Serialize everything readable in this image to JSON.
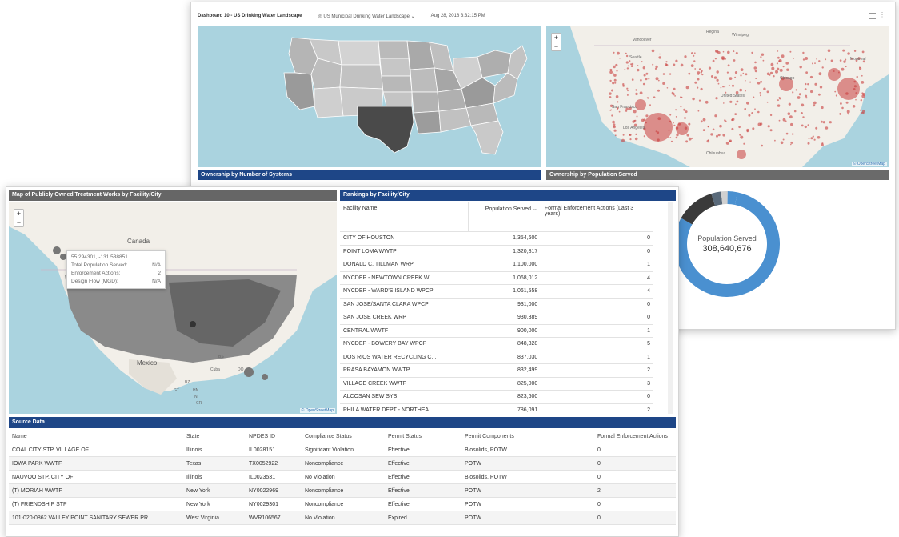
{
  "dashboard": {
    "title": "Dashboard 10 - US Drinking Water Landscape",
    "datasource": "US Municipal Drinking Water Landscape",
    "timestamp": "Aug 28, 2018 3:32:15 PM"
  },
  "panels": {
    "ownership_systems": "Ownership by Number of Systems",
    "ownership_population": "Ownership by Population Served",
    "potw_map": "Map of Publicly Owned Treatment Works by Facility/City",
    "rankings": "Rankings by Facility/City",
    "source_data": "Source Data"
  },
  "attribution": "© OpenStreetMap",
  "zoom": {
    "plus": "+",
    "minus": "−"
  },
  "map_labels": {
    "vancouver": "Vancouver",
    "regina": "Regina",
    "winnipeg": "Winnipeg",
    "seattle": "Seattle",
    "montreal": "Montreal",
    "united_states": "United States",
    "chicago": "Chicago",
    "san_francisco": "San Francisco",
    "los_angeles": "Los Angeles",
    "chihuahua": "Chihuahua",
    "canada": "Canada",
    "mexico": "Mexico",
    "cuba": "Cuba",
    "bs": "BS",
    "do": "DO",
    "bz": "BZ",
    "gt": "GT",
    "hn": "HN",
    "ni": "NI",
    "cr": "CR"
  },
  "donut": {
    "label": "Population Served",
    "value": "308,640,676",
    "segments": [
      {
        "fraction": 0.8,
        "color": "#4a90d0"
      },
      {
        "fraction": 0.12,
        "color": "#3a3a3a"
      },
      {
        "fraction": 0.03,
        "color": "#5a6a7a"
      },
      {
        "fraction": 0.02,
        "color": "#d0d0d0"
      },
      {
        "fraction": 0.03,
        "color": "#4a90d0"
      }
    ]
  },
  "tooltip": {
    "coords": "55.294301, -131.538851",
    "rows": [
      {
        "label": "Total Population Served:",
        "value": "N/A"
      },
      {
        "label": "Enforcement Actions:",
        "value": "2"
      },
      {
        "label": "Design Flow (MGD):",
        "value": "N/A"
      }
    ]
  },
  "rankings": {
    "columns": [
      "Facility Name",
      "Population Served",
      "Formal Enforcement Actions (Last 3 years)"
    ],
    "rows": [
      [
        "CITY OF HOUSTON",
        "1,354,600",
        "0"
      ],
      [
        "POINT LOMA WWTP",
        "1,320,817",
        "0"
      ],
      [
        "DONALD C. TILLMAN WRP",
        "1,100,000",
        "1"
      ],
      [
        "NYCDEP - NEWTOWN CREEK W...",
        "1,068,012",
        "4"
      ],
      [
        "NYCDEP - WARD'S ISLAND WPCP",
        "1,061,558",
        "4"
      ],
      [
        "SAN JOSE/SANTA CLARA WPCP",
        "931,000",
        "0"
      ],
      [
        "SAN JOSE CREEK WRP",
        "930,389",
        "0"
      ],
      [
        "CENTRAL WWTF",
        "900,000",
        "1"
      ],
      [
        "NYCDEP - BOWERY BAY WPCP",
        "848,328",
        "5"
      ],
      [
        "DOS RIOS WATER RECYCLING C...",
        "837,030",
        "1"
      ],
      [
        "PRASA BAYAMON WWTP",
        "832,499",
        "2"
      ],
      [
        "VILLAGE CREEK WWTF",
        "825,000",
        "3"
      ],
      [
        "ALCOSAN SEW SYS",
        "823,600",
        "0"
      ],
      [
        "PHILA WATER DEPT - NORTHEA...",
        "786,091",
        "2"
      ]
    ]
  },
  "source": {
    "columns": [
      "Name",
      "State",
      "NPDES ID",
      "Compliance Status",
      "Permit Status",
      "Permit Components",
      "Formal Enforcement Actions"
    ],
    "rows": [
      [
        "COAL CITY STP, VILLAGE OF",
        "Illinois",
        "IL0028151",
        "Significant Violation",
        "Effective",
        "Biosolids, POTW",
        "0"
      ],
      [
        "IOWA PARK WWTF",
        "Texas",
        "TX0052922",
        "Noncompliance",
        "Effective",
        "POTW",
        "0"
      ],
      [
        "NAUVOO STP, CITY OF",
        "Illinois",
        "IL0023531",
        "No Violation",
        "Effective",
        "Biosolids, POTW",
        "0"
      ],
      [
        "(T) MORIAH WWTF",
        "New York",
        "NY0022969",
        "Noncompliance",
        "Effective",
        "POTW",
        "2"
      ],
      [
        "(T) FRIENDSHIP STP",
        "New York",
        "NY0029301",
        "Noncompliance",
        "Effective",
        "POTW",
        "0"
      ],
      [
        "101-020-0862 VALLEY POINT SANITARY SEWER PR...",
        "West Virginia",
        "WVR106567",
        "No Violation",
        "Expired",
        "POTW",
        "0"
      ]
    ]
  }
}
